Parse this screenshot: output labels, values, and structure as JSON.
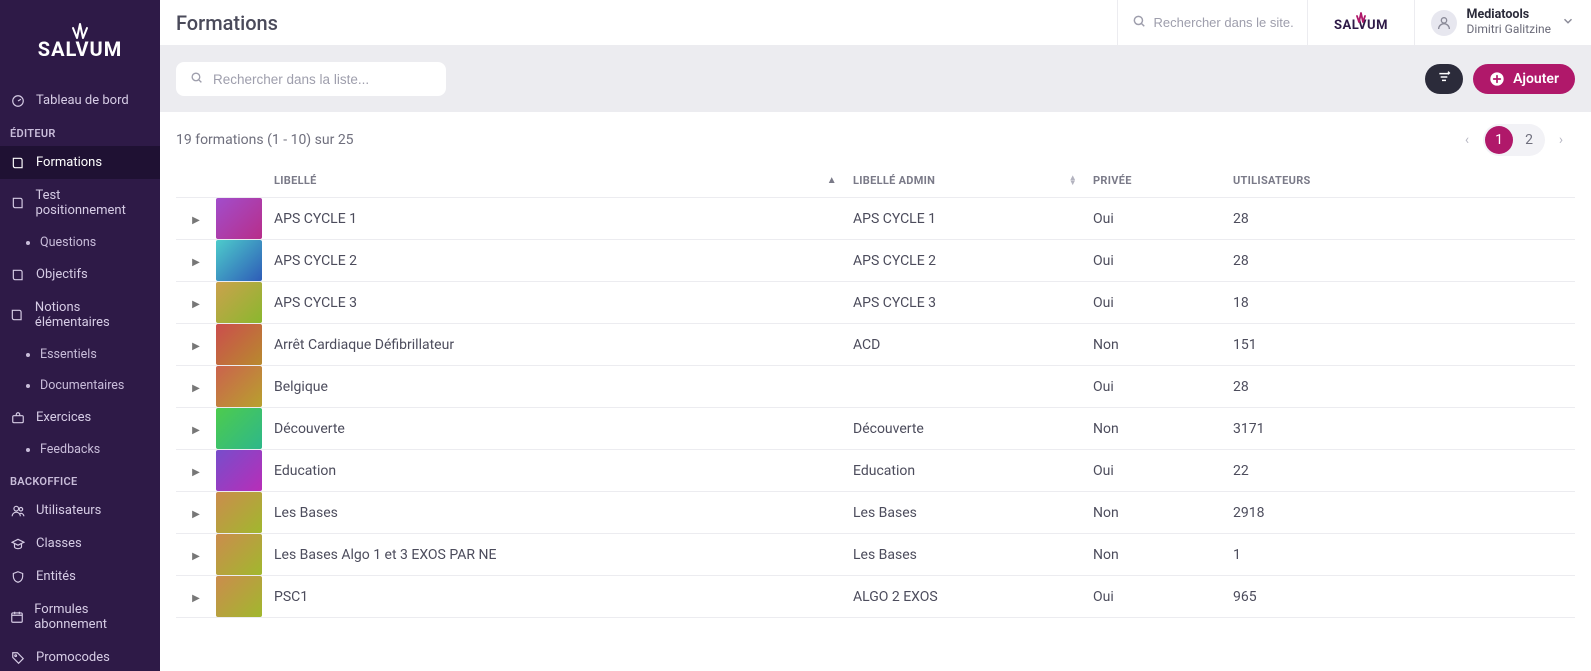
{
  "brand": "SALVUM",
  "accent": "#b0186a",
  "page_title": "Formations",
  "site_search_placeholder": "Rechercher dans le site...",
  "list_search_placeholder": "Rechercher dans la liste...",
  "user": {
    "org": "Mediatools",
    "name": "Dimitri Galitzine"
  },
  "sort_button_title": "Trier",
  "add_button_label": "Ajouter",
  "count_text": "19 formations (1 - 10) sur 25",
  "pagination": {
    "pages": [
      "1",
      "2"
    ],
    "current": "1"
  },
  "columns": {
    "libelle": "LIBELLÉ",
    "libelle_admin": "LIBELLÉ ADMIN",
    "privee": "PRIVÉE",
    "utilisateurs": "UTILISATEURS"
  },
  "sidebar": {
    "dashboard": "Tableau de bord",
    "section_editor": "ÉDITEUR",
    "formations": "Formations",
    "test_positionnement": "Test positionnement",
    "questions": "Questions",
    "objectifs": "Objectifs",
    "notions": "Notions élémentaires",
    "essentiels": "Essentiels",
    "documentaires": "Documentaires",
    "exercices": "Exercices",
    "feedbacks": "Feedbacks",
    "section_backoffice": "BACKOFFICE",
    "utilisateurs": "Utilisateurs",
    "classes": "Classes",
    "entites": "Entités",
    "formules": "Formules abonnement",
    "promocodes": "Promocodes"
  },
  "rows": [
    {
      "libelle": "APS CYCLE 1",
      "admin": "APS CYCLE 1",
      "privee": "Oui",
      "users": "28",
      "hue": 280
    },
    {
      "libelle": "APS CYCLE 2",
      "admin": "APS CYCLE 2",
      "privee": "Oui",
      "users": "28",
      "hue": 180
    },
    {
      "libelle": "APS CYCLE 3",
      "admin": "APS CYCLE 3",
      "privee": "Oui",
      "users": "18",
      "hue": 40
    },
    {
      "libelle": "Arrêt Cardiaque Défibrillateur",
      "admin": "ACD",
      "privee": "Non",
      "users": "151",
      "hue": 0
    },
    {
      "libelle": "Belgique",
      "admin": "",
      "privee": "Oui",
      "users": "28",
      "hue": 10
    },
    {
      "libelle": "Découverte",
      "admin": "Découverte",
      "privee": "Non",
      "users": "3171",
      "hue": 120
    },
    {
      "libelle": "Education",
      "admin": "Education",
      "privee": "Oui",
      "users": "22",
      "hue": 260
    },
    {
      "libelle": "Les Bases",
      "admin": "Les Bases",
      "privee": "Non",
      "users": "2918",
      "hue": 30
    },
    {
      "libelle": "Les Bases Algo 1 et 3 EXOS PAR NE",
      "admin": "Les Bases",
      "privee": "Non",
      "users": "1",
      "hue": 30
    },
    {
      "libelle": "PSC1",
      "admin": "ALGO 2 EXOS",
      "privee": "Oui",
      "users": "965",
      "hue": 30
    }
  ]
}
